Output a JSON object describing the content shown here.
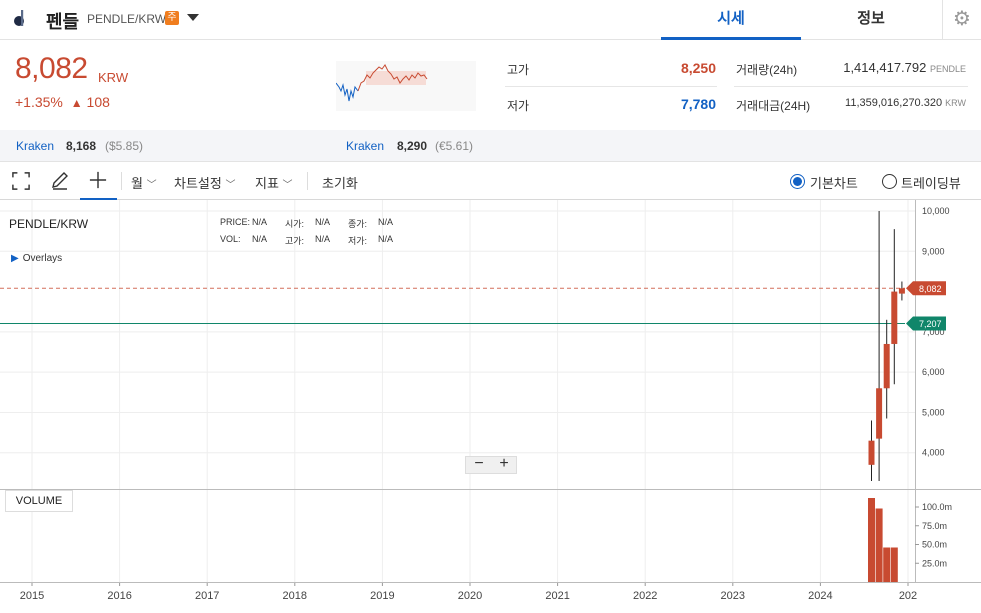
{
  "header": {
    "coin_name": "펜들",
    "pair": "PENDLE/KRW",
    "warning_badge": "주",
    "tabs": [
      "시세",
      "정보"
    ]
  },
  "price": {
    "current": "8,082",
    "unit": "KRW",
    "change_rate": "+1.35%",
    "change_arrow": "▲",
    "change_value": "108"
  },
  "stats": {
    "high_label": "고가",
    "high_value": "8,250",
    "low_label": "저가",
    "low_value": "7,780",
    "volume_label": "거래량(24h)",
    "volume_value": "1,414,417.792",
    "volume_unit": "PENDLE",
    "amount_label": "거래대금(24H)",
    "amount_value": "11,359,016,270.320",
    "amount_unit": "KRW"
  },
  "exchanges": [
    {
      "name": "Kraken",
      "price": "8,168",
      "foreign": "($5.85)"
    },
    {
      "name": "Kraken",
      "price": "8,290",
      "foreign": "(€5.61)"
    }
  ],
  "toolbar": {
    "period": "월",
    "chart_settings": "차트설정",
    "indicators": "지표",
    "reset": "초기화",
    "basic_chart": "기본차트",
    "tradingview": "트레이딩뷰"
  },
  "legend": {
    "title": "PENDLE/KRW",
    "price_label": "PRICE:",
    "price_value": "N/A",
    "open_label": "시가:",
    "open_value": "N/A",
    "close_label": "종가:",
    "close_value": "N/A",
    "vol_label": "VOL:",
    "vol_value": "N/A",
    "high_label": "고가:",
    "high_value": "N/A",
    "low_label": "저가:",
    "low_value": "N/A",
    "overlays": "Overlays",
    "volume_tag": "VOLUME"
  },
  "chart_data": {
    "type": "candlestick",
    "x_ticks": [
      "2015",
      "2016",
      "2017",
      "2018",
      "2019",
      "2020",
      "2021",
      "2022",
      "2023",
      "2024",
      "202"
    ],
    "y_ticks": [
      {
        "label": "10,000",
        "value": 10000
      },
      {
        "label": "9,000",
        "value": 9000
      },
      {
        "label": "7,000",
        "value": 7000
      },
      {
        "label": "6,000",
        "value": 6000
      },
      {
        "label": "5,000",
        "value": 5000
      },
      {
        "label": "4,000",
        "value": 4000
      }
    ],
    "ylim": [
      3100,
      10050
    ],
    "current_price": {
      "label": "8,082",
      "value": 8082,
      "color": "#c84a31"
    },
    "ref_line": {
      "label": "7,207",
      "value": 7207,
      "color": "#10866a"
    },
    "candles": [
      {
        "open": 3700,
        "close": 4300,
        "high": 4800,
        "low": 3300
      },
      {
        "open": 4350,
        "close": 5600,
        "high": 10000,
        "low": 3300
      },
      {
        "open": 5600,
        "close": 6700,
        "high": 7300,
        "low": 4850
      },
      {
        "open": 6700,
        "close": 8000,
        "high": 9550,
        "low": 5700
      },
      {
        "open": 7950,
        "close": 8082,
        "high": 8250,
        "low": 7780
      }
    ],
    "volume_ticks": [
      {
        "label": "100.0m",
        "value": 100
      },
      {
        "label": "75.0m",
        "value": 75
      },
      {
        "label": "50.0m",
        "value": 50
      },
      {
        "label": "25.0m",
        "value": 25
      }
    ],
    "volume_max": 112,
    "volumes": [
      112,
      98,
      46,
      46,
      0
    ]
  },
  "colors": {
    "up": "#c84a31",
    "down": "#1261c4",
    "accent": "#1261c4"
  }
}
